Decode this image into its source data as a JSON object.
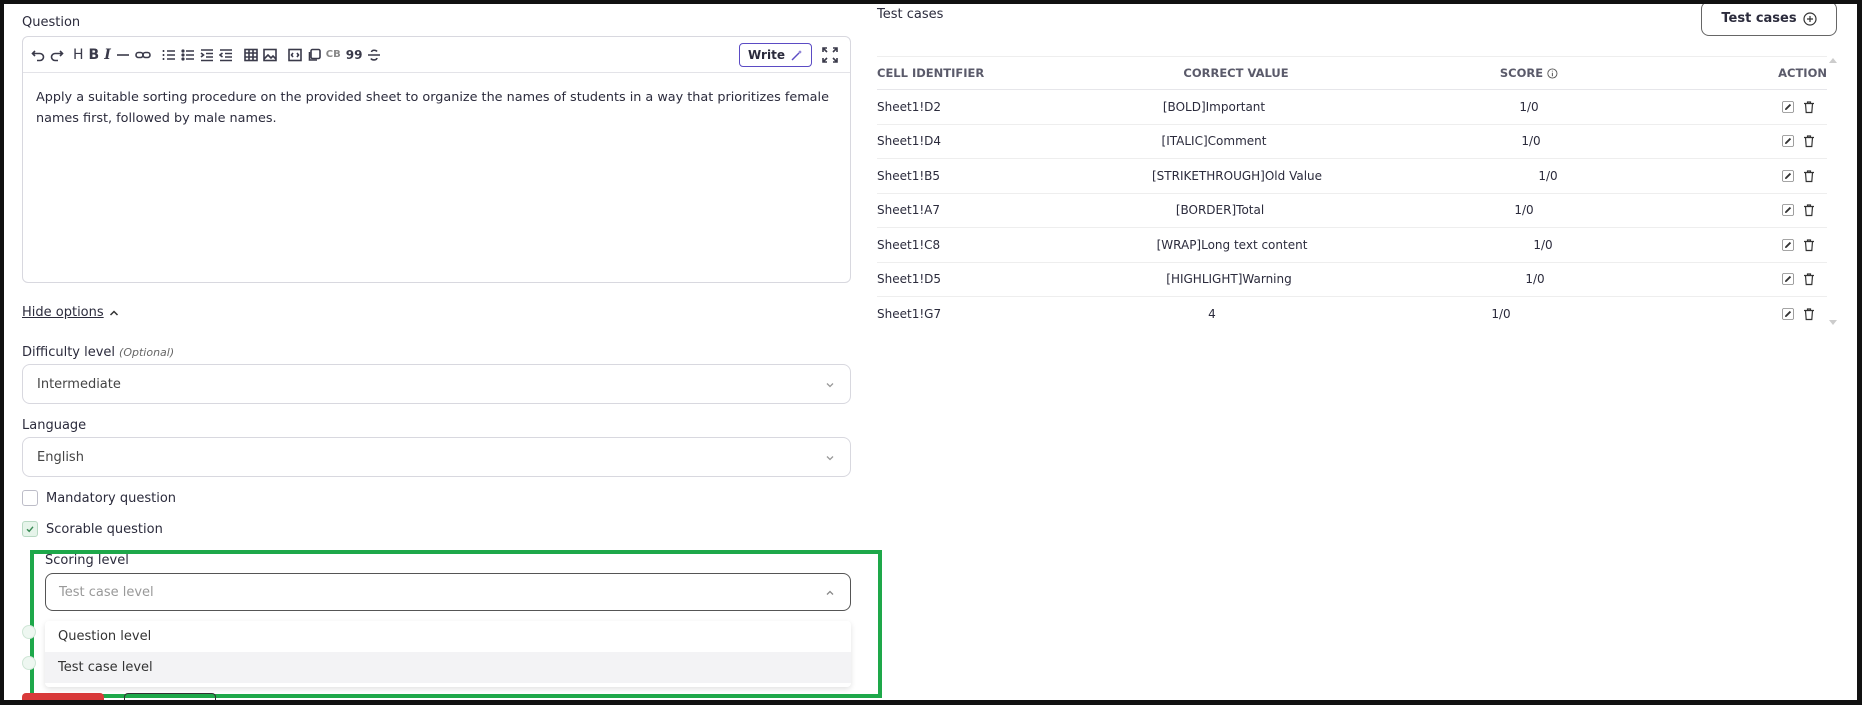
{
  "question": {
    "label": "Question",
    "write_button": "Write",
    "toolbar_labels": {
      "heading": "H",
      "bold": "B",
      "italic": "I",
      "codeblock": "CB",
      "quote": "99"
    },
    "body": "Apply a suitable sorting procedure on the provided sheet to organize the names of students in a way that prioritizes female names first, followed by male names."
  },
  "options_toggle": "Hide options",
  "difficulty": {
    "label": "Difficulty level",
    "optional": "(Optional)",
    "value": "Intermediate"
  },
  "language": {
    "label": "Language",
    "value": "English"
  },
  "checkboxes": [
    {
      "label": "Mandatory question",
      "checked": false
    },
    {
      "label": "Scorable question",
      "checked": true
    }
  ],
  "scoring": {
    "label": "Scoring level",
    "placeholder": "Test case level",
    "options": [
      "Question level",
      "Test case level"
    ]
  },
  "highlight_color": "#1ea84a",
  "test_cases": {
    "title": "Test cases",
    "button": "Test cases",
    "headers": {
      "id": "CELL IDENTIFIER",
      "value": "CORRECT VALUE",
      "score": "SCORE",
      "action": "ACTION"
    },
    "rows": [
      {
        "id": "Sheet1!D2",
        "value": "[BOLD]Important",
        "score": "1/0"
      },
      {
        "id": "Sheet1!D4",
        "value": "[ITALIC]Comment",
        "score": "1/0"
      },
      {
        "id": "Sheet1!B5",
        "value": "[STRIKETHROUGH]Old Value",
        "score": "1/0"
      },
      {
        "id": "Sheet1!A7",
        "value": "[BORDER]Total",
        "score": "1/0"
      },
      {
        "id": "Sheet1!C8",
        "value": "[WRAP]Long text content",
        "score": "1/0"
      },
      {
        "id": "Sheet1!D5",
        "value": "[HIGHLIGHT]Warning",
        "score": "1/0"
      },
      {
        "id": "Sheet1!G7",
        "value": "4",
        "score": "1/0"
      }
    ]
  }
}
